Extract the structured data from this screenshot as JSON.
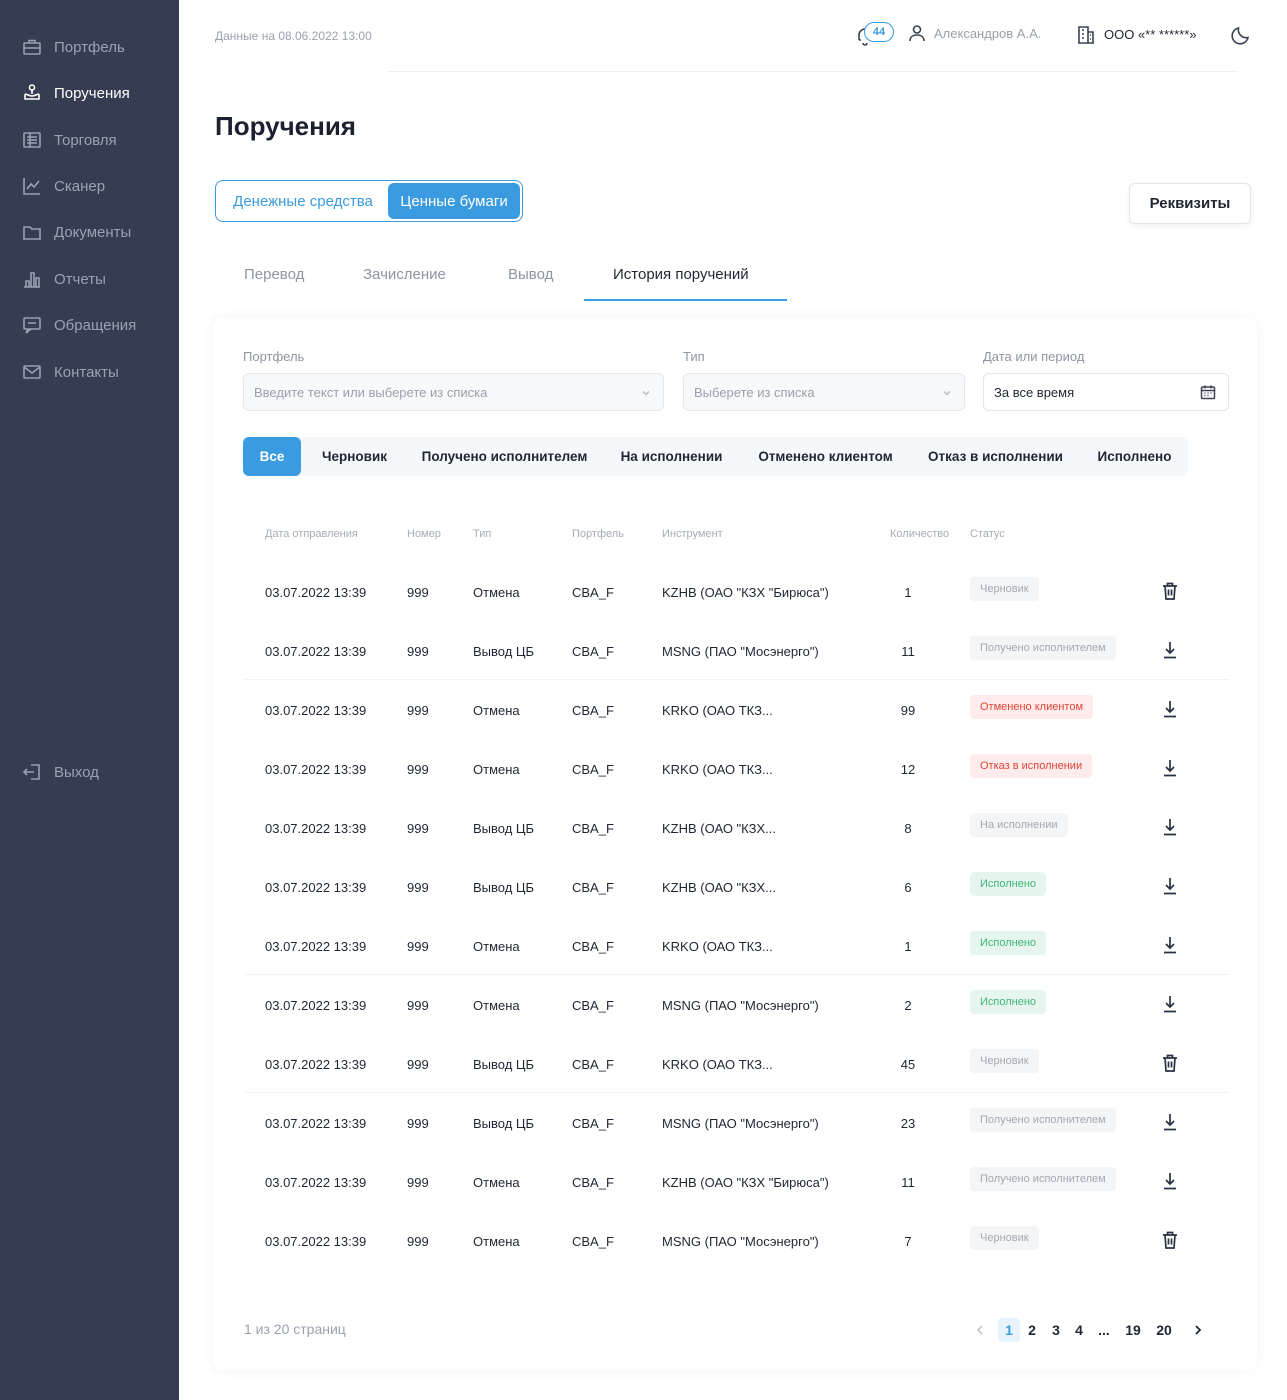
{
  "sidebar": {
    "items": [
      {
        "label": "Портфель",
        "icon": "briefcase-icon",
        "active": false
      },
      {
        "label": "Поручения",
        "icon": "hand-coin-icon",
        "active": true
      },
      {
        "label": "Торговля",
        "icon": "trading-icon",
        "active": false
      },
      {
        "label": "Сканер",
        "icon": "chart-line-icon",
        "active": false
      },
      {
        "label": "Документы",
        "icon": "folder-icon",
        "active": false
      },
      {
        "label": "Отчеты",
        "icon": "bar-chart-icon",
        "active": false
      },
      {
        "label": "Обращения",
        "icon": "message-icon",
        "active": false
      },
      {
        "label": "Контакты",
        "icon": "mail-icon",
        "active": false
      }
    ],
    "logout": "Выход"
  },
  "header": {
    "data_date": "Данные на 08.06.2022 13:00",
    "notifications": "44",
    "user": "Александров А.А.",
    "org": "ООО «** ******»"
  },
  "page": {
    "title": "Поручения"
  },
  "segment": {
    "money": "Денежные средства",
    "securities": "Ценные бумаги"
  },
  "requisites_button": "Реквизиты",
  "tabs": [
    "Перевод",
    "Зачисление",
    "Вывод",
    "История поручений"
  ],
  "filters": {
    "portfolio_label": "Портфель",
    "portfolio_placeholder": "Введите текст или выберете из списка",
    "type_label": "Тип",
    "type_placeholder": "Выберете из списка",
    "date_label": "Дата или период",
    "date_value": "За все время"
  },
  "status_filters": [
    "Все",
    "Черновик",
    "Получено исполнителем",
    "На исполнении",
    "Отменено клиентом",
    "Отказ в исполнении",
    "Исполнено"
  ],
  "table": {
    "columns": [
      "Дата отправления",
      "Номер",
      "Тип",
      "Портфель",
      "Инструмент",
      "Количество",
      "Статус"
    ],
    "rows": [
      {
        "date": "03.07.2022 13:39",
        "number": "999",
        "type": "Отмена",
        "portfolio": "CBA_F",
        "instrument": "KZHB (ОАО \"КЗХ \"Бирюса\")",
        "qty": "1",
        "status": "Черновик",
        "tone": "gray",
        "action": "trash"
      },
      {
        "date": "03.07.2022 13:39",
        "number": "999",
        "type": "Вывод ЦБ",
        "portfolio": "CBA_F",
        "instrument": "MSNG (ПАО \"Мосэнерго\")",
        "qty": "11",
        "status": "Получено исполнителем",
        "tone": "gray",
        "action": "download"
      },
      {
        "date": "03.07.2022 13:39",
        "number": "999",
        "type": "Отмена",
        "portfolio": "CBA_F",
        "instrument": "KRKO (ОАО ТКЗ...",
        "qty": "99",
        "status": "Отменено клиентом",
        "tone": "red",
        "action": "download"
      },
      {
        "date": "03.07.2022 13:39",
        "number": "999",
        "type": "Отмена",
        "portfolio": "CBA_F",
        "instrument": "KRKO (ОАО ТКЗ...",
        "qty": "12",
        "status": "Отказ в исполнении",
        "tone": "red",
        "action": "download"
      },
      {
        "date": "03.07.2022 13:39",
        "number": "999",
        "type": "Вывод ЦБ",
        "portfolio": "CBA_F",
        "instrument": "KZHB (ОАО \"КЗХ...",
        "qty": "8",
        "status": "На исполнении",
        "tone": "gray",
        "action": "download"
      },
      {
        "date": "03.07.2022 13:39",
        "number": "999",
        "type": "Вывод ЦБ",
        "portfolio": "CBA_F",
        "instrument": "KZHB (ОАО \"КЗХ...",
        "qty": "6",
        "status": "Исполнено",
        "tone": "green",
        "action": "download"
      },
      {
        "date": "03.07.2022 13:39",
        "number": "999",
        "type": "Отмена",
        "portfolio": "CBA_F",
        "instrument": "KRKO (ОАО ТКЗ...",
        "qty": "1",
        "status": "Исполнено",
        "tone": "green",
        "action": "download"
      },
      {
        "date": "03.07.2022 13:39",
        "number": "999",
        "type": "Отмена",
        "portfolio": "CBA_F",
        "instrument": "MSNG (ПАО \"Мосэнерго\")",
        "qty": "2",
        "status": "Исполнено",
        "tone": "green",
        "action": "download"
      },
      {
        "date": "03.07.2022 13:39",
        "number": "999",
        "type": "Вывод ЦБ",
        "portfolio": "CBA_F",
        "instrument": "KRKO (ОАО ТКЗ...",
        "qty": "45",
        "status": "Черновик",
        "tone": "gray",
        "action": "trash"
      },
      {
        "date": "03.07.2022 13:39",
        "number": "999",
        "type": "Вывод ЦБ",
        "portfolio": "CBA_F",
        "instrument": "MSNG (ПАО \"Мосэнерго\")",
        "qty": "23",
        "status": "Получено исполнителем",
        "tone": "gray",
        "action": "download"
      },
      {
        "date": "03.07.2022 13:39",
        "number": "999",
        "type": "Отмена",
        "portfolio": "CBA_F",
        "instrument": "KZHB (ОАО \"КЗХ \"Бирюса\")",
        "qty": "11",
        "status": "Получено исполнителем",
        "tone": "gray",
        "action": "download"
      },
      {
        "date": "03.07.2022 13:39",
        "number": "999",
        "type": "Отмена",
        "portfolio": "CBA_F",
        "instrument": "MSNG (ПАО \"Мосэнерго\")",
        "qty": "7",
        "status": "Черновик",
        "tone": "gray",
        "action": "trash"
      }
    ]
  },
  "pagination": {
    "info": "1 из 20 страниц",
    "pages": [
      "1",
      "2",
      "3",
      "4",
      "...",
      "19",
      "20"
    ],
    "current": "1"
  },
  "colors": {
    "accent": "#3a9be0",
    "sidebar": "#363d52",
    "danger": "#e0443a",
    "success": "#3fb77a"
  }
}
